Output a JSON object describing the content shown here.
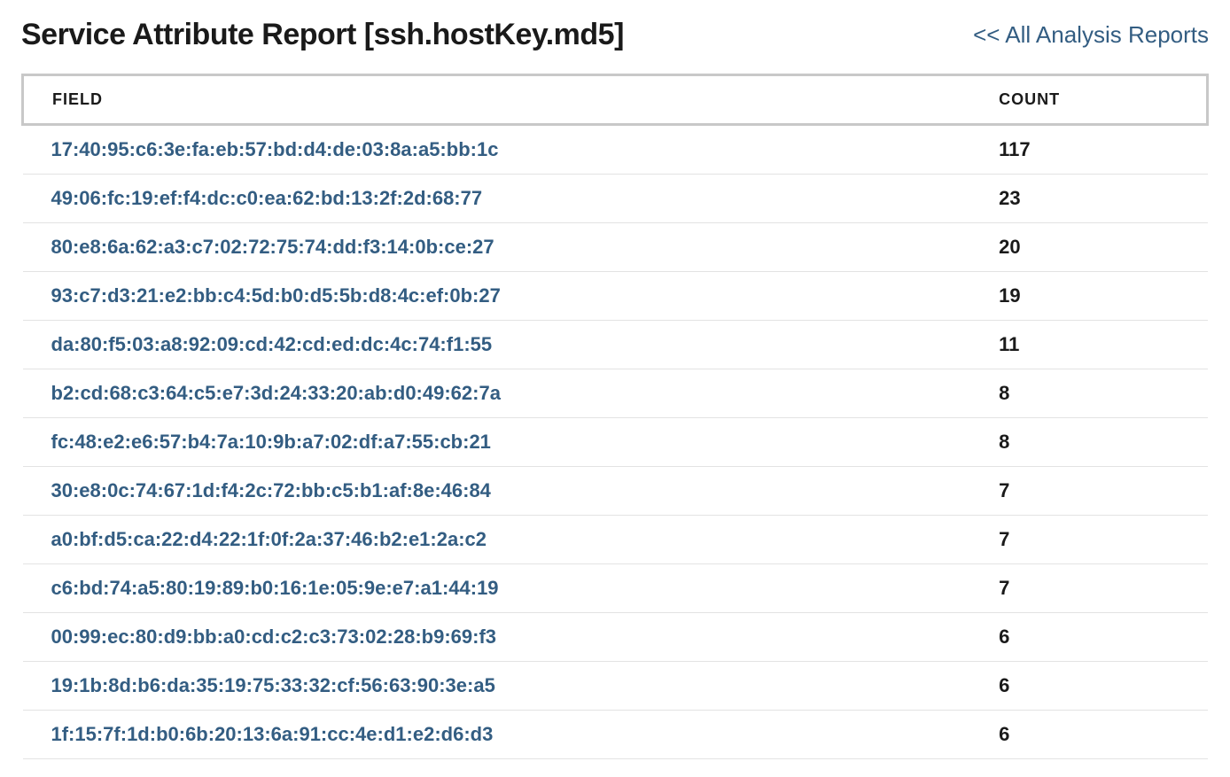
{
  "header": {
    "title": "Service Attribute Report [ssh.hostKey.md5]",
    "back_link": "<< All Analysis Reports"
  },
  "table": {
    "columns": {
      "field": "FIELD",
      "count": "COUNT"
    },
    "rows": [
      {
        "field": "17:40:95:c6:3e:fa:eb:57:bd:d4:de:03:8a:a5:bb:1c",
        "count": "117"
      },
      {
        "field": "49:06:fc:19:ef:f4:dc:c0:ea:62:bd:13:2f:2d:68:77",
        "count": "23"
      },
      {
        "field": "80:e8:6a:62:a3:c7:02:72:75:74:dd:f3:14:0b:ce:27",
        "count": "20"
      },
      {
        "field": "93:c7:d3:21:e2:bb:c4:5d:b0:d5:5b:d8:4c:ef:0b:27",
        "count": "19"
      },
      {
        "field": "da:80:f5:03:a8:92:09:cd:42:cd:ed:dc:4c:74:f1:55",
        "count": "11"
      },
      {
        "field": "b2:cd:68:c3:64:c5:e7:3d:24:33:20:ab:d0:49:62:7a",
        "count": "8"
      },
      {
        "field": "fc:48:e2:e6:57:b4:7a:10:9b:a7:02:df:a7:55:cb:21",
        "count": "8"
      },
      {
        "field": "30:e8:0c:74:67:1d:f4:2c:72:bb:c5:b1:af:8e:46:84",
        "count": "7"
      },
      {
        "field": "a0:bf:d5:ca:22:d4:22:1f:0f:2a:37:46:b2:e1:2a:c2",
        "count": "7"
      },
      {
        "field": "c6:bd:74:a5:80:19:89:b0:16:1e:05:9e:e7:a1:44:19",
        "count": "7"
      },
      {
        "field": "00:99:ec:80:d9:bb:a0:cd:c2:c3:73:02:28:b9:69:f3",
        "count": "6"
      },
      {
        "field": "19:1b:8d:b6:da:35:19:75:33:32:cf:56:63:90:3e:a5",
        "count": "6"
      },
      {
        "field": "1f:15:7f:1d:b0:6b:20:13:6a:91:cc:4e:d1:e2:d6:d3",
        "count": "6"
      }
    ]
  }
}
